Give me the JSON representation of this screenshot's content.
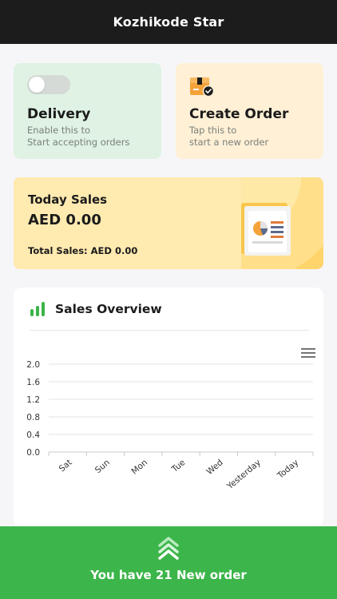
{
  "header": {
    "title": "Kozhikode Star"
  },
  "delivery_card": {
    "title": "Delivery",
    "desc_line1": "Enable this to",
    "desc_line2": "Start accepting orders",
    "toggle_on": false
  },
  "create_card": {
    "icon": "package-check-icon",
    "title": "Create Order",
    "desc_line1": "Tap this to",
    "desc_line2": "start a new order"
  },
  "sales_card": {
    "label": "Today Sales",
    "amount": "AED 0.00",
    "total": "Total Sales: AED 0.00",
    "icon": "report-chart-icon"
  },
  "overview": {
    "title": "Sales Overview",
    "icon": "bar-chart-icon",
    "menu_icon": "hamburger-menu-icon"
  },
  "chart_data": {
    "type": "line",
    "title": "",
    "xlabel": "",
    "ylabel": "",
    "categories": [
      "Sat",
      "Sun",
      "Mon",
      "Tue",
      "Wed",
      "Yesterday",
      "Today"
    ],
    "y_ticks": [
      "2.0",
      "1.6",
      "1.2",
      "0.8",
      "0.4",
      "0.0"
    ],
    "ylim": [
      0,
      2.0
    ],
    "series": [
      {
        "values": [
          0,
          0,
          0,
          0,
          0,
          0,
          0
        ]
      }
    ],
    "grid": true
  },
  "footer": {
    "text": "You have 21 New order",
    "icon": "double-chevron-up-icon"
  },
  "colors": {
    "header_bg": "#1c1c1c",
    "delivery_bg": "#dff2e4",
    "create_bg": "#fff0d6",
    "sales_bg": "#ffeab0",
    "accent_orange": "#f4a23a",
    "footer_bg": "#3cb54a",
    "chart_green": "#3cb54a"
  }
}
